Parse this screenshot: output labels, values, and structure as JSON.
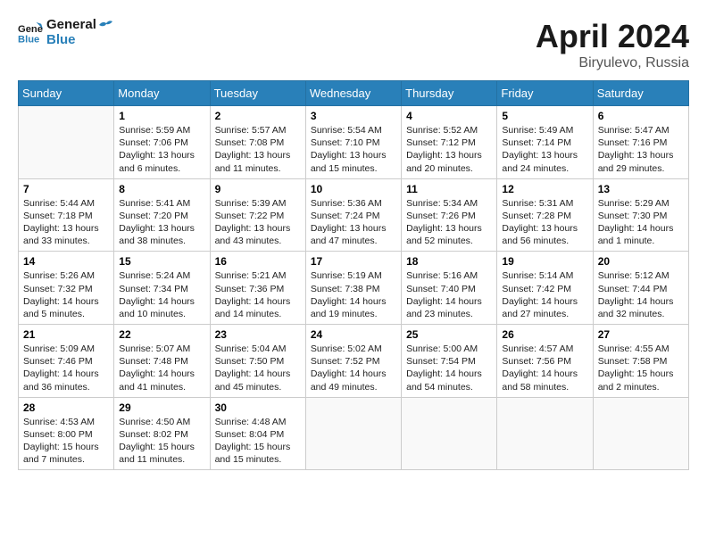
{
  "header": {
    "logo_line1": "General",
    "logo_line2": "Blue",
    "month_year": "April 2024",
    "location": "Biryulevo, Russia"
  },
  "weekdays": [
    "Sunday",
    "Monday",
    "Tuesday",
    "Wednesday",
    "Thursday",
    "Friday",
    "Saturday"
  ],
  "weeks": [
    [
      {
        "day": "",
        "info": ""
      },
      {
        "day": "1",
        "info": "Sunrise: 5:59 AM\nSunset: 7:06 PM\nDaylight: 13 hours\nand 6 minutes."
      },
      {
        "day": "2",
        "info": "Sunrise: 5:57 AM\nSunset: 7:08 PM\nDaylight: 13 hours\nand 11 minutes."
      },
      {
        "day": "3",
        "info": "Sunrise: 5:54 AM\nSunset: 7:10 PM\nDaylight: 13 hours\nand 15 minutes."
      },
      {
        "day": "4",
        "info": "Sunrise: 5:52 AM\nSunset: 7:12 PM\nDaylight: 13 hours\nand 20 minutes."
      },
      {
        "day": "5",
        "info": "Sunrise: 5:49 AM\nSunset: 7:14 PM\nDaylight: 13 hours\nand 24 minutes."
      },
      {
        "day": "6",
        "info": "Sunrise: 5:47 AM\nSunset: 7:16 PM\nDaylight: 13 hours\nand 29 minutes."
      }
    ],
    [
      {
        "day": "7",
        "info": "Sunrise: 5:44 AM\nSunset: 7:18 PM\nDaylight: 13 hours\nand 33 minutes."
      },
      {
        "day": "8",
        "info": "Sunrise: 5:41 AM\nSunset: 7:20 PM\nDaylight: 13 hours\nand 38 minutes."
      },
      {
        "day": "9",
        "info": "Sunrise: 5:39 AM\nSunset: 7:22 PM\nDaylight: 13 hours\nand 43 minutes."
      },
      {
        "day": "10",
        "info": "Sunrise: 5:36 AM\nSunset: 7:24 PM\nDaylight: 13 hours\nand 47 minutes."
      },
      {
        "day": "11",
        "info": "Sunrise: 5:34 AM\nSunset: 7:26 PM\nDaylight: 13 hours\nand 52 minutes."
      },
      {
        "day": "12",
        "info": "Sunrise: 5:31 AM\nSunset: 7:28 PM\nDaylight: 13 hours\nand 56 minutes."
      },
      {
        "day": "13",
        "info": "Sunrise: 5:29 AM\nSunset: 7:30 PM\nDaylight: 14 hours\nand 1 minute."
      }
    ],
    [
      {
        "day": "14",
        "info": "Sunrise: 5:26 AM\nSunset: 7:32 PM\nDaylight: 14 hours\nand 5 minutes."
      },
      {
        "day": "15",
        "info": "Sunrise: 5:24 AM\nSunset: 7:34 PM\nDaylight: 14 hours\nand 10 minutes."
      },
      {
        "day": "16",
        "info": "Sunrise: 5:21 AM\nSunset: 7:36 PM\nDaylight: 14 hours\nand 14 minutes."
      },
      {
        "day": "17",
        "info": "Sunrise: 5:19 AM\nSunset: 7:38 PM\nDaylight: 14 hours\nand 19 minutes."
      },
      {
        "day": "18",
        "info": "Sunrise: 5:16 AM\nSunset: 7:40 PM\nDaylight: 14 hours\nand 23 minutes."
      },
      {
        "day": "19",
        "info": "Sunrise: 5:14 AM\nSunset: 7:42 PM\nDaylight: 14 hours\nand 27 minutes."
      },
      {
        "day": "20",
        "info": "Sunrise: 5:12 AM\nSunset: 7:44 PM\nDaylight: 14 hours\nand 32 minutes."
      }
    ],
    [
      {
        "day": "21",
        "info": "Sunrise: 5:09 AM\nSunset: 7:46 PM\nDaylight: 14 hours\nand 36 minutes."
      },
      {
        "day": "22",
        "info": "Sunrise: 5:07 AM\nSunset: 7:48 PM\nDaylight: 14 hours\nand 41 minutes."
      },
      {
        "day": "23",
        "info": "Sunrise: 5:04 AM\nSunset: 7:50 PM\nDaylight: 14 hours\nand 45 minutes."
      },
      {
        "day": "24",
        "info": "Sunrise: 5:02 AM\nSunset: 7:52 PM\nDaylight: 14 hours\nand 49 minutes."
      },
      {
        "day": "25",
        "info": "Sunrise: 5:00 AM\nSunset: 7:54 PM\nDaylight: 14 hours\nand 54 minutes."
      },
      {
        "day": "26",
        "info": "Sunrise: 4:57 AM\nSunset: 7:56 PM\nDaylight: 14 hours\nand 58 minutes."
      },
      {
        "day": "27",
        "info": "Sunrise: 4:55 AM\nSunset: 7:58 PM\nDaylight: 15 hours\nand 2 minutes."
      }
    ],
    [
      {
        "day": "28",
        "info": "Sunrise: 4:53 AM\nSunset: 8:00 PM\nDaylight: 15 hours\nand 7 minutes."
      },
      {
        "day": "29",
        "info": "Sunrise: 4:50 AM\nSunset: 8:02 PM\nDaylight: 15 hours\nand 11 minutes."
      },
      {
        "day": "30",
        "info": "Sunrise: 4:48 AM\nSunset: 8:04 PM\nDaylight: 15 hours\nand 15 minutes."
      },
      {
        "day": "",
        "info": ""
      },
      {
        "day": "",
        "info": ""
      },
      {
        "day": "",
        "info": ""
      },
      {
        "day": "",
        "info": ""
      }
    ]
  ]
}
